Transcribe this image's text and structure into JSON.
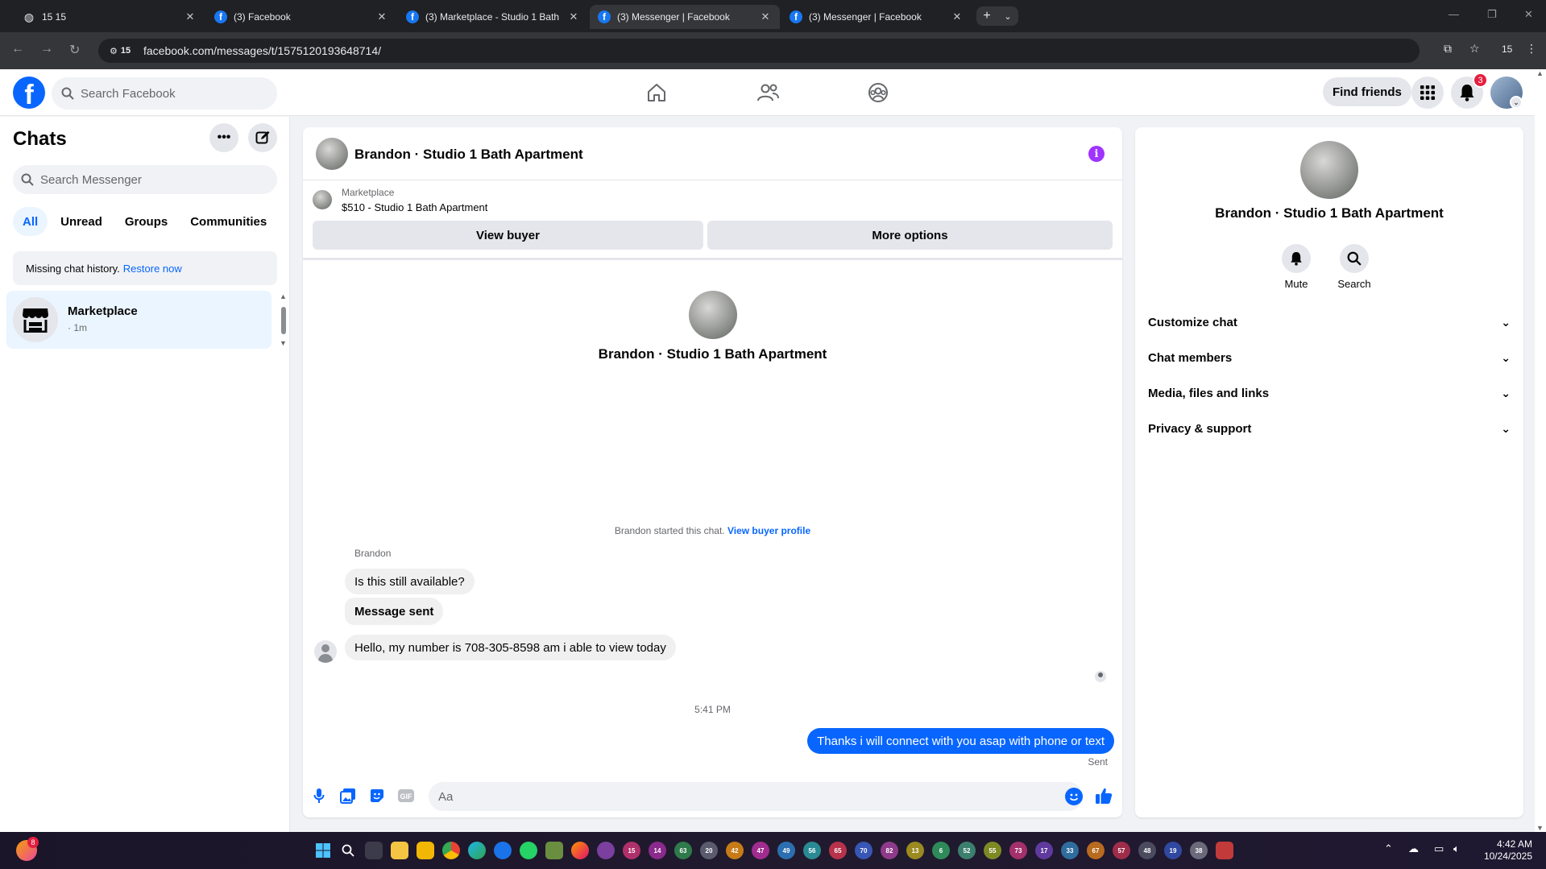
{
  "browser": {
    "tabs": [
      {
        "title": "15 15",
        "favicon": "globe-icon"
      },
      {
        "title": "(3) Facebook",
        "favicon": "facebook-icon"
      },
      {
        "title": "(3) Marketplace - Studio 1 Bath",
        "favicon": "facebook-icon"
      },
      {
        "title": "(3) Messenger | Facebook",
        "favicon": "facebook-icon",
        "active": true
      },
      {
        "title": "(3) Messenger | Facebook",
        "favicon": "facebook-icon"
      }
    ],
    "site_badge": "15",
    "url": "facebook.com/messages/t/1575120193648714/",
    "profile_label": "15"
  },
  "fb_header": {
    "logo": "f",
    "search_placeholder": "Search Facebook",
    "find_friends": "Find friends",
    "notification_count": "3"
  },
  "sidebar": {
    "title": "Chats",
    "search_placeholder": "Search Messenger",
    "filters": [
      "All",
      "Unread",
      "Groups",
      "Communities"
    ],
    "active_filter": "All",
    "missing_history": "Missing chat history.",
    "restore_link": "Restore now",
    "chats": [
      {
        "name": "Marketplace",
        "subtitle": "· 1m"
      }
    ]
  },
  "conversation": {
    "title": "Brandon · Studio 1 Bath Apartment",
    "marketplace_label": "Marketplace",
    "listing": "$510 - Studio 1 Bath Apartment",
    "view_buyer": "View buyer",
    "more_options": "More options",
    "intro_name": "Brandon · Studio 1 Bath Apartment",
    "started_text": "Brandon started this chat.",
    "view_profile_link": "View buyer profile",
    "sender_name": "Brandon",
    "messages_in": [
      "Is this still available?",
      "Message sent",
      "Hello,  my number is 708-305-8598 am i able to view today"
    ],
    "timestamp": "5:41 PM",
    "message_out": "Thanks i will  connect with you asap with phone or text",
    "status": "Sent",
    "input_placeholder": "Aa"
  },
  "info_panel": {
    "name": "Brandon · Studio 1 Bath Apartment",
    "mute_label": "Mute",
    "search_label": "Search",
    "sections": [
      "Customize chat",
      "Chat members",
      "Media, files and links",
      "Privacy & support"
    ]
  },
  "taskbar": {
    "weather_badge": "8",
    "app_badges": [
      "15",
      "14",
      "63",
      "20",
      "42",
      "47",
      "49",
      "56",
      "65",
      "70",
      "82",
      "13",
      "6",
      "52",
      "55",
      "73",
      "17",
      "33",
      "67",
      "57",
      "48",
      "19",
      "38"
    ],
    "time": "4:42 AM",
    "date": "10/24/2025"
  },
  "colors": {
    "facebook_blue": "#0866ff",
    "info_purple": "#a033ff",
    "badge_red": "#e41e3f"
  }
}
